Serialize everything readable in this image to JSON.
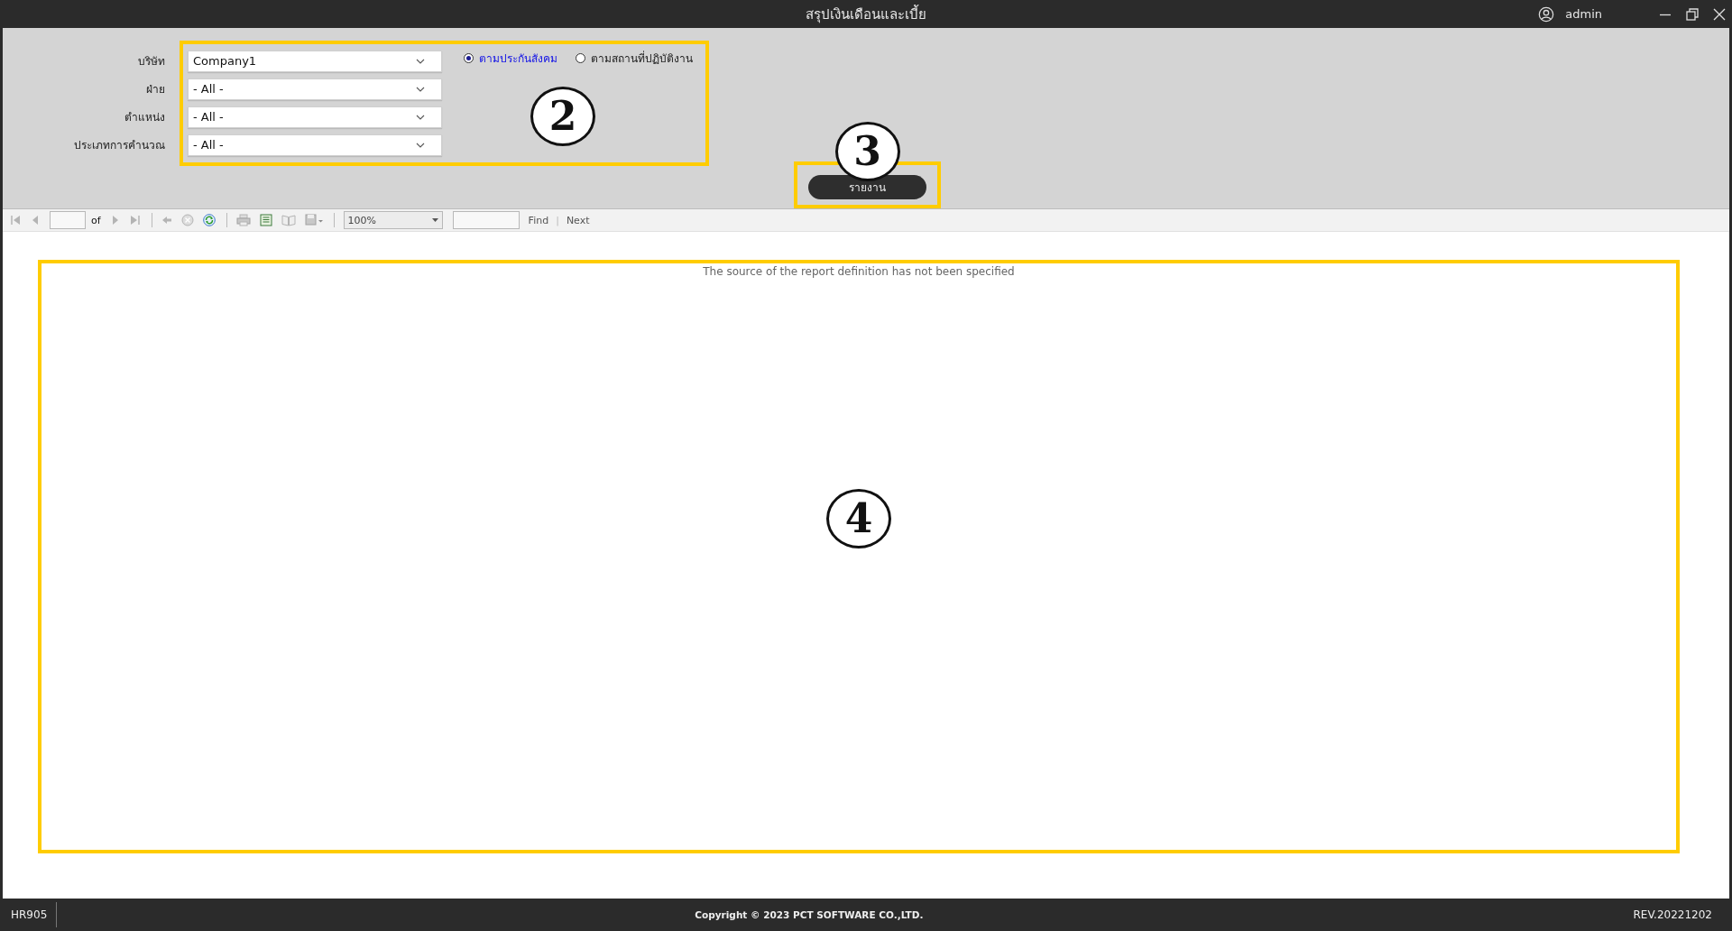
{
  "window": {
    "title": "สรุปเงินเดือนและเบี้ย",
    "user": "admin"
  },
  "filters": [
    {
      "label": "บริษัท",
      "value": "Company1"
    },
    {
      "label": "ฝ่าย",
      "value": "- All -"
    },
    {
      "label": "ตำแหน่ง",
      "value": "- All -"
    },
    {
      "label": "ประเภทการคำนวณ",
      "value": "- All -"
    }
  ],
  "report_basis": [
    {
      "label": "ตามประกันสังคม",
      "selected": true
    },
    {
      "label": "ตามสถานที่ปฏิบัติงาน",
      "selected": false
    }
  ],
  "report_button": {
    "label": "รายงาน"
  },
  "report_toolbar": {
    "page_of": "of",
    "zoom": "100%",
    "find": "Find",
    "separator": "|",
    "next": "Next"
  },
  "report_message": "The source of the report definition has not been specified",
  "annotations": [
    {
      "kind": "filters",
      "number": "2"
    },
    {
      "kind": "button",
      "number": "3"
    },
    {
      "kind": "viewer",
      "number": "4"
    }
  ],
  "status_bar": {
    "code": "HR905",
    "copyright": "Copyright © 2023 PCT SOFTWARE CO.,LTD.",
    "revision": "REV.20221202"
  }
}
